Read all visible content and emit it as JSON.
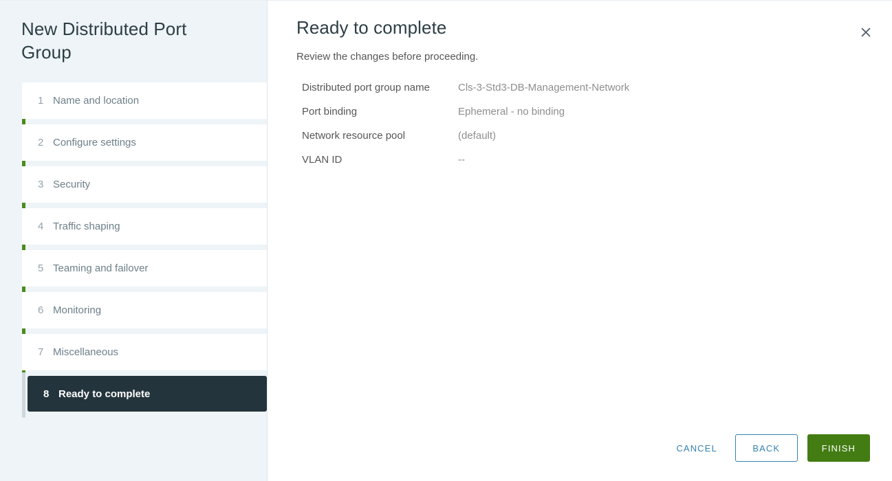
{
  "wizard": {
    "title": "New Distributed Port Group",
    "close_label": "close-icon"
  },
  "sidebar": {
    "steps": [
      {
        "num": "1",
        "label": "Name and location"
      },
      {
        "num": "2",
        "label": "Configure settings"
      },
      {
        "num": "3",
        "label": "Security"
      },
      {
        "num": "4",
        "label": "Traffic shaping"
      },
      {
        "num": "5",
        "label": "Teaming and failover"
      },
      {
        "num": "6",
        "label": "Monitoring"
      },
      {
        "num": "7",
        "label": "Miscellaneous"
      },
      {
        "num": "8",
        "label": "Ready to complete"
      }
    ]
  },
  "main": {
    "title": "Ready to complete",
    "subtitle": "Review the changes before proceeding.",
    "summary": [
      {
        "label": "Distributed port group name",
        "value": "Cls-3-Std3-DB-Management-Network"
      },
      {
        "label": "Port binding",
        "value": "Ephemeral - no binding"
      },
      {
        "label": "Network resource pool",
        "value": "(default)"
      },
      {
        "label": "VLAN ID",
        "value": "--"
      }
    ]
  },
  "footer": {
    "cancel_label": "CANCEL",
    "back_label": "BACK",
    "finish_label": "FINISH"
  },
  "colors": {
    "accent_green": "#4c8a1e",
    "finish_green": "#437c13",
    "link_blue": "#3382b0",
    "active_step_bg": "#24343c",
    "sidebar_bg": "#eef4f7"
  }
}
